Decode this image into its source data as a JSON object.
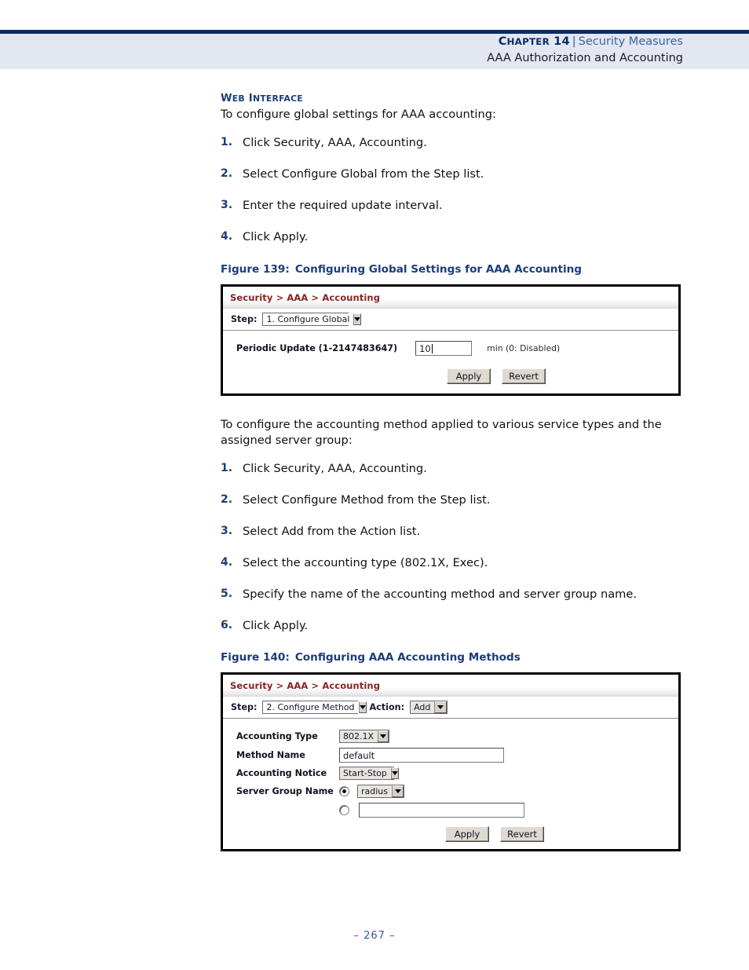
{
  "header": {
    "chapter_label": "Chapter 14",
    "chapter_label_lead": "C",
    "chapter_label_rest": "HAPTER",
    "chapter_number": "14",
    "separator": "|",
    "chapter_topic": "Security Measures",
    "subtitle": "AAA Authorization and Accounting"
  },
  "section": {
    "kicker_lead": "W",
    "kicker_rest": "EB",
    "kicker_lead2": "I",
    "kicker_rest2": "NTERFACE",
    "kicker_full": "WEB INTERFACE",
    "lead": "To configure global settings for AAA accounting:"
  },
  "steps_global": [
    {
      "num": "1.",
      "text": "Click Security, AAA, Accounting."
    },
    {
      "num": "2.",
      "text": "Select Configure Global from the Step list."
    },
    {
      "num": "3.",
      "text": "Enter the required update interval."
    },
    {
      "num": "4.",
      "text": "Click Apply."
    }
  ],
  "figure139": {
    "caption_num": "Figure 139:",
    "caption_text": "Configuring Global Settings for AAA Accounting",
    "breadcrumb": "Security > AAA > Accounting",
    "step_label": "Step:",
    "step_value": "1. Configure Global",
    "periodic_label": "Periodic Update (1-2147483647)",
    "periodic_value": "10",
    "periodic_hint": "min (0: Disabled)",
    "apply_label": "Apply",
    "revert_label": "Revert"
  },
  "lead2": {
    "line1": "To configure the accounting method applied to various service types and",
    "line2": "the assigned server group:"
  },
  "steps_method": [
    {
      "num": "1.",
      "text": "Click Security, AAA, Accounting."
    },
    {
      "num": "2.",
      "text": "Select Configure Method from the Step list."
    },
    {
      "num": "3.",
      "text": "Select Add from the Action list."
    },
    {
      "num": "4.",
      "text": "Select the accounting type (802.1X, Exec)."
    },
    {
      "num": "5.",
      "text": "Specify the name of the accounting method and server group name."
    },
    {
      "num": "6.",
      "text": "Click Apply."
    }
  ],
  "figure140": {
    "caption_num": "Figure 140:",
    "caption_text": "Configuring AAA Accounting Methods",
    "breadcrumb": "Security > AAA > Accounting",
    "step_label": "Step:",
    "step_value": "2. Configure Method",
    "action_label": "Action:",
    "action_value": "Add",
    "accounting_type_label": "Accounting Type",
    "accounting_type_value": "802.1X",
    "method_name_label": "Method Name",
    "method_name_value": "default",
    "accounting_notice_label": "Accounting Notice",
    "accounting_notice_value": "Start-Stop",
    "server_group_label": "Server Group Name",
    "server_group_value": "radius",
    "server_group_custom_value": "",
    "apply_label": "Apply",
    "revert_label": "Revert"
  },
  "footer": {
    "page_number": "–  267  –"
  },
  "colors": {
    "header_rule": "#072c64",
    "header_band": "#e3e7f1",
    "heading_blue": "#1b3d7a",
    "link_blue": "#3c63a5",
    "breadcrumb_red": "#8a2220",
    "footer_blue": "#3a5894"
  }
}
